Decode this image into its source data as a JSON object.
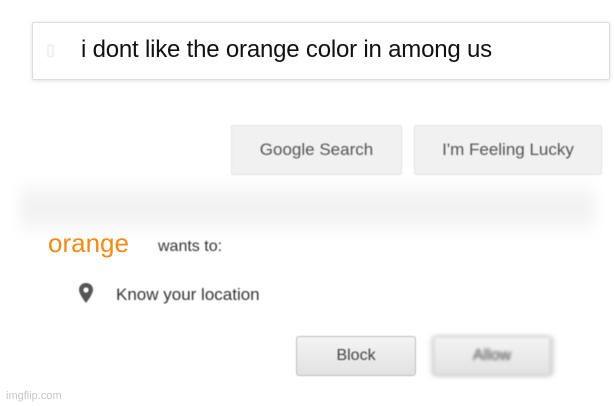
{
  "search": {
    "query": "i dont like the orange color in among us"
  },
  "buttons": {
    "google_search": "Google Search",
    "feeling_lucky": "I'm Feeling Lucky"
  },
  "permission": {
    "site": "orange",
    "wants_to": "wants to:",
    "item": "Know your location",
    "item_icon": "location-pin-icon",
    "block_label": "Block",
    "allow_label": "Allow"
  },
  "colors": {
    "site_accent": "#f28a16"
  },
  "watermark": "imgflip.com"
}
